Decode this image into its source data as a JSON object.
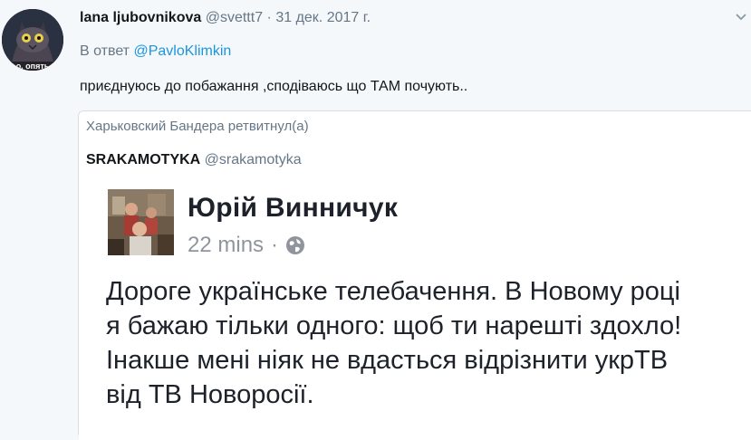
{
  "tweet": {
    "author_name": "lana ljubovnikova",
    "author_handle": "@svettt7",
    "separator": "·",
    "date": "31 дек. 2017 г.",
    "reply_prefix": "В ответ",
    "reply_mention": "@PavloKlimkin",
    "text": "приєднуюсь до побажання ,сподіваюсь що ТАМ почують.."
  },
  "avatar": {
    "caption": "о, опять"
  },
  "quote": {
    "retweeted_by": "Харьковский Бандера ретвитнул(а)",
    "author_name": "SRAKAMOTYKA",
    "author_handle": "@srakamotyka",
    "fb_post": {
      "author_name": "Юрій Винничук",
      "time": "22 mins",
      "separator": "·",
      "privacy_icon": "globe-icon",
      "lines": [
        "Дороге українське телебачення. В Новому році",
        "я бажаю тільки одного: щоб ти нарешті здохло!",
        "Інакше мені ніяк не вдасться відрізнити укрТВ",
        "від ТВ Новоросії."
      ]
    }
  },
  "colors": {
    "background": "#f5f8fa",
    "link": "#1b95e0",
    "muted": "#657786",
    "fb_text": "#1d2129",
    "fb_muted": "#90949c"
  }
}
